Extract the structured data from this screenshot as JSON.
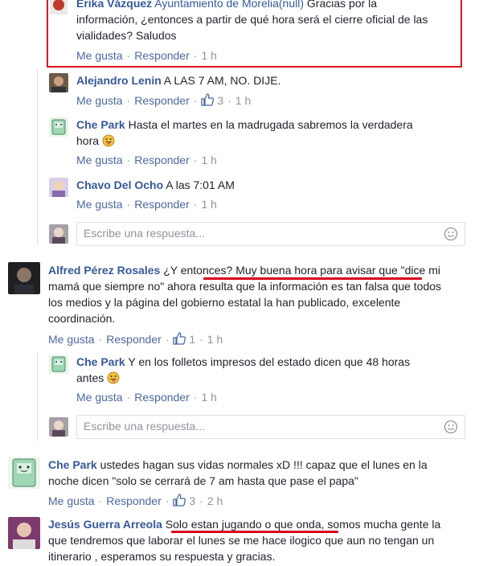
{
  "comments": {
    "erika": {
      "name": "Erika Vázquez",
      "tag": "Ayuntamiento de Morelia(null)",
      "line1": " Gracias por la",
      "line2": "información, ¿entonces a partir de qué hora será el cierre oficial de las",
      "line3": "vialidades? Saludos",
      "like": "Me gusta",
      "reply": "Responder",
      "time": "1 h"
    },
    "alejandro": {
      "name": "Alejandro Lenin",
      "text": "A LAS 7 AM, NO. DIJE.",
      "like": "Me gusta",
      "reply": "Responder",
      "likes": "3",
      "time": "1 h"
    },
    "chepark1": {
      "name": "Che Park",
      "line1": "Hasta el martes en la madrugada sabremos la verdadera",
      "line2": "hora",
      "like": "Me gusta",
      "reply": "Responder",
      "time": "1 h"
    },
    "chavo": {
      "name": "Chavo Del Ocho",
      "text": "A las 7:01 AM",
      "like": "Me gusta",
      "reply": "Responder",
      "time": "1 h"
    },
    "reply1": {
      "placeholder": "Escribe una respuesta..."
    },
    "alfred": {
      "name": "Alfred Pérez Rosales",
      "line1": "¿Y entonces? Muy buena hora para avisar que \"dice mi",
      "line2": "mamá que siempre no\" ahora resulta que la información es tan falsa que todos",
      "line3": "los medios y la página del gobierno estatal la han publicado, excelente",
      "line4": "coordinación.",
      "like": "Me gusta",
      "reply": "Responder",
      "likes": "1",
      "time": "1 h"
    },
    "chepark2": {
      "name": "Che Park",
      "line1": "Y en los folletos impresos del estado dicen que 48 horas",
      "line2": "antes",
      "like": "Me gusta",
      "reply": "Responder",
      "time": "1 h"
    },
    "reply2": {
      "placeholder": "Escribe una respuesta..."
    },
    "chepark3": {
      "name": "Che Park",
      "line1": "ustedes hagan sus vidas normales xD !!! capaz que el lunes en la",
      "line2": "noche dicen \"solo se cerrará de 7 am hasta que pase el papa\"",
      "like": "Me gusta",
      "reply": "Responder",
      "likes": "3",
      "time": "2 h"
    },
    "jesus": {
      "name": "Jesús Guerra Arreola",
      "line1": "Solo estan jugando o que onda,",
      "line1b": " somos mucha gente la",
      "line2": "que tendremos que laborar el lunes se me hace ilogico que aun no tengan un",
      "line3": "itinerario , esperamos su respuesta y gracias."
    }
  },
  "colors": {
    "link": "#365899",
    "meta": "#90949c",
    "annotation": "#d9001b"
  }
}
